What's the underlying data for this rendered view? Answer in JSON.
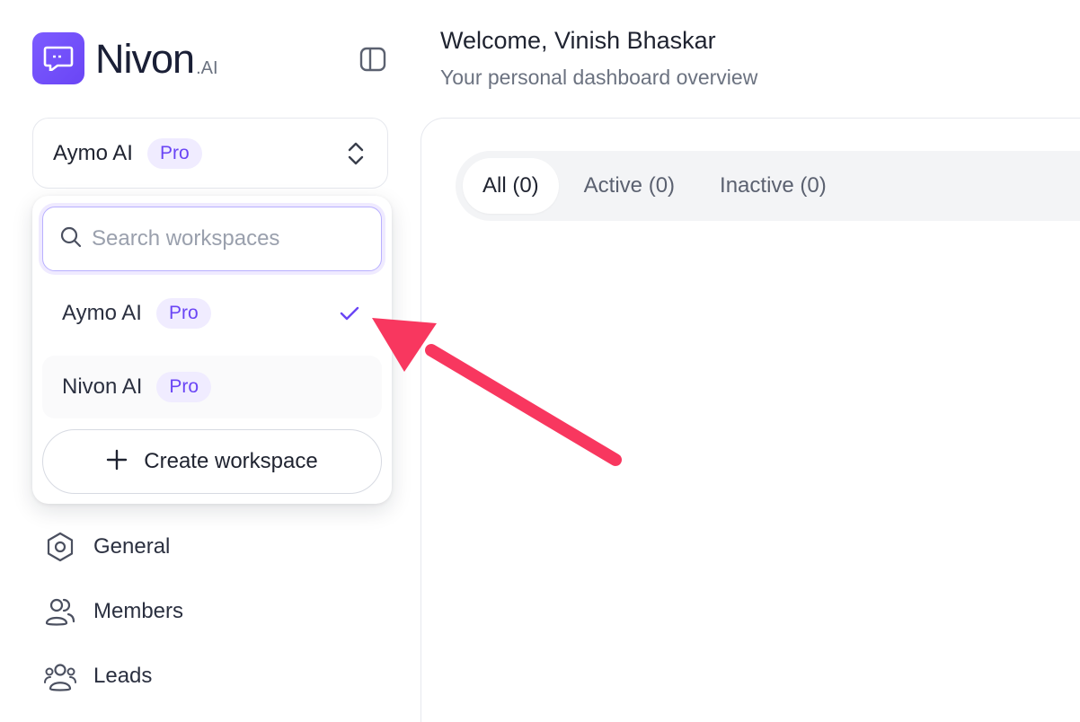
{
  "brand": {
    "name": "Nivon",
    "suffix": ".AI",
    "accent": "#6a45f5"
  },
  "sidebar": {
    "collapse_icon": "sidebar-toggle-icon",
    "workspace_switcher": {
      "current": "Aymo AI",
      "badge": "Pro"
    },
    "dropdown": {
      "search_placeholder": "Search workspaces",
      "search_value": "",
      "items": [
        {
          "name": "Aymo AI",
          "badge": "Pro",
          "selected": true
        },
        {
          "name": "Nivon AI",
          "badge": "Pro",
          "selected": false
        }
      ],
      "create_label": "Create workspace"
    },
    "nav": [
      {
        "label": "General",
        "icon": "hexagon-settings-icon"
      },
      {
        "label": "Members",
        "icon": "users-icon"
      },
      {
        "label": "Leads",
        "icon": "leads-icon"
      }
    ]
  },
  "header": {
    "title": "Welcome, Vinish Bhaskar",
    "subtitle": "Your personal dashboard overview"
  },
  "tabs": [
    {
      "label": "All (0)",
      "active": true
    },
    {
      "label": "Active (0)",
      "active": false
    },
    {
      "label": "Inactive (0)",
      "active": false
    }
  ],
  "annotation": {
    "arrow_color": "#f8375f"
  }
}
